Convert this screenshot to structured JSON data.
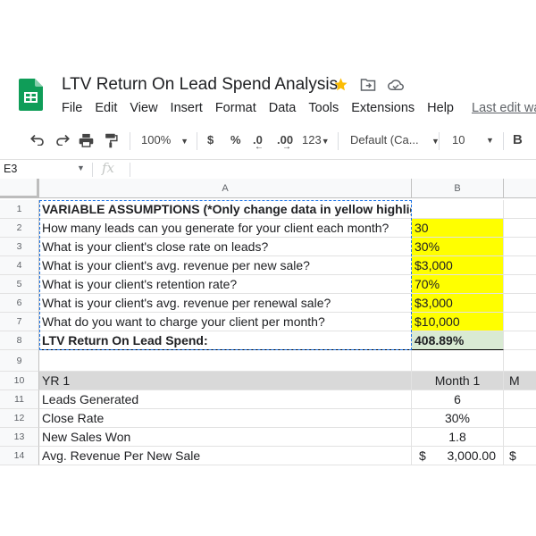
{
  "doc": {
    "title": "LTV Return On Lead Spend Analysis"
  },
  "menu": [
    "File",
    "Edit",
    "View",
    "Insert",
    "Format",
    "Data",
    "Tools",
    "Extensions",
    "Help"
  ],
  "last_edit": "Last edit wa",
  "toolbar": {
    "zoom": "100%",
    "currency": "$",
    "percent": "%",
    "dec_decrease": ".0",
    "dec_increase": ".00",
    "more_formats": "123",
    "font": "Default (Ca...",
    "font_size": "10",
    "bold": "B"
  },
  "namebox": "E3",
  "fx": "fx",
  "columns": [
    "A",
    "B"
  ],
  "rows": [
    {
      "num": "1",
      "a": "VARIABLE ASSUMPTIONS (*Only change data in yellow highlighted cells)",
      "b": "",
      "c": ""
    },
    {
      "num": "2",
      "a": "How many leads can you generate for your client each month?",
      "b": "30",
      "c": ""
    },
    {
      "num": "3",
      "a": "What is your client's close rate on leads?",
      "b": "30%",
      "c": ""
    },
    {
      "num": "4",
      "a": "What is your client's avg. revenue per new sale?",
      "b": "$3,000",
      "c": ""
    },
    {
      "num": "5",
      "a": "What is your client's retention rate?",
      "b": "70%",
      "c": ""
    },
    {
      "num": "6",
      "a": "What is your client's avg. revenue per renewal sale?",
      "b": "$3,000",
      "c": ""
    },
    {
      "num": "7",
      "a": "What do you want to charge your client per month?",
      "b": "$10,000",
      "c": ""
    },
    {
      "num": "8",
      "a": "LTV Return On Lead Spend:",
      "b": "408.89%",
      "c": ""
    },
    {
      "num": "9",
      "a": "",
      "b": "",
      "c": ""
    },
    {
      "num": "10",
      "a": "YR 1",
      "b": "Month 1",
      "c": "M"
    },
    {
      "num": "11",
      "a": "Leads Generated",
      "b": "6",
      "c": ""
    },
    {
      "num": "12",
      "a": "Close Rate",
      "b": "30%",
      "c": ""
    },
    {
      "num": "13",
      "a": "New Sales Won",
      "b": "1.8",
      "c": ""
    },
    {
      "num": "14",
      "a": "Avg. Revenue Per New Sale",
      "b_sym": "$",
      "b": "3,000.00",
      "c": "$"
    }
  ],
  "colors": {
    "highlight_yellow": "#ffff00",
    "result_green": "#d9ead3",
    "header_gray": "#d9d9d9",
    "selection_blue": "#1a73e8",
    "sheets_green": "#0f9d58"
  }
}
